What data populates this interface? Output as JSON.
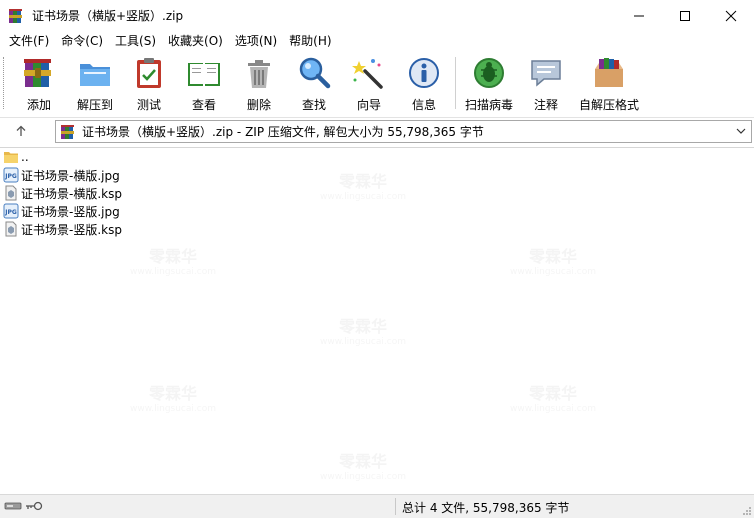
{
  "window": {
    "title": "证书场景（横版+竖版）.zip",
    "app_icon": "winrar-books-icon"
  },
  "menu": [
    {
      "label": "文件(F)"
    },
    {
      "label": "命令(C)"
    },
    {
      "label": "工具(S)"
    },
    {
      "label": "收藏夹(O)"
    },
    {
      "label": "选项(N)"
    },
    {
      "label": "帮助(H)"
    }
  ],
  "toolbar": [
    {
      "label": "添加",
      "icon": "add-archive-icon"
    },
    {
      "label": "解压到",
      "icon": "extract-folder-icon"
    },
    {
      "label": "测试",
      "icon": "test-clipboard-icon"
    },
    {
      "label": "查看",
      "icon": "view-book-icon"
    },
    {
      "label": "删除",
      "icon": "trash-icon"
    },
    {
      "label": "查找",
      "icon": "find-magnifier-icon"
    },
    {
      "label": "向导",
      "icon": "wizard-wand-icon"
    },
    {
      "label": "信息",
      "icon": "info-icon"
    },
    {
      "label": "扫描病毒",
      "icon": "virus-scan-icon"
    },
    {
      "label": "注释",
      "icon": "comment-icon"
    },
    {
      "label": "自解压格式",
      "icon": "sfx-box-icon"
    }
  ],
  "address": {
    "text": "证书场景（横版+竖版）.zip - ZIP 压缩文件, 解包大小为 55,798,365 字节"
  },
  "files": [
    {
      "name": "..",
      "type": "folder-up"
    },
    {
      "name": "证书场景-横版.jpg",
      "type": "jpg"
    },
    {
      "name": "证书场景-横版.ksp",
      "type": "ksp"
    },
    {
      "name": "证书场景-竖版.jpg",
      "type": "jpg"
    },
    {
      "name": "证书场景-竖版.ksp",
      "type": "ksp"
    }
  ],
  "status": {
    "summary": "总计 4 文件, 55,798,365 字节"
  },
  "watermark": {
    "text": "零霖华",
    "url": "www.lingsucai.com"
  },
  "colors": {
    "selection": "#cce8ff",
    "statusbar_bg": "#f0f0f0",
    "border": "#a8a8a8"
  }
}
